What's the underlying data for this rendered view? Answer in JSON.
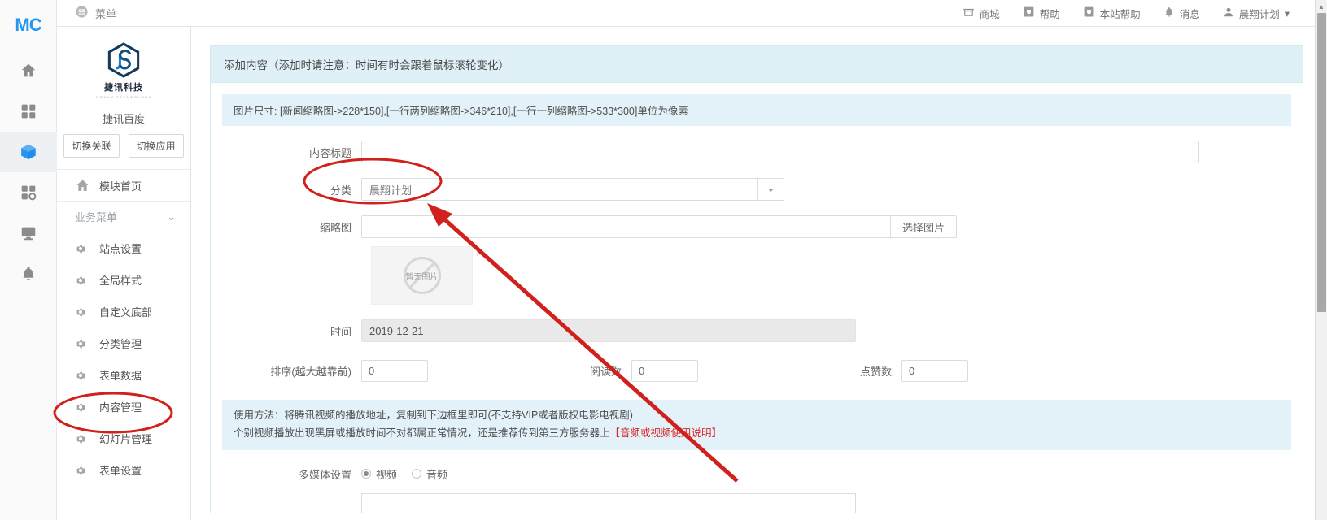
{
  "brand": {
    "logo_text": "MC"
  },
  "icon_rail": [
    {
      "name": "home-icon",
      "label": "首页"
    },
    {
      "name": "grid-icon",
      "label": "应用"
    },
    {
      "name": "cube-icon",
      "label": "模块",
      "active": true
    },
    {
      "name": "grid-settings-icon",
      "label": "设置"
    },
    {
      "name": "monitor-icon",
      "label": "监控"
    },
    {
      "name": "bell-icon",
      "label": "通知"
    }
  ],
  "topbar": {
    "menu_label": "菜单",
    "right_items": [
      {
        "icon": "shop-icon",
        "label": "商城"
      },
      {
        "icon": "help-icon",
        "label": "帮助"
      },
      {
        "icon": "site-help-icon",
        "label": "本站帮助"
      },
      {
        "icon": "bell-icon",
        "label": "消息"
      },
      {
        "icon": "user-icon",
        "label": "晨翔计划",
        "caret": "▾"
      }
    ]
  },
  "sidebar": {
    "logo_main": "捷讯科技",
    "logo_tiny": "JIEXUN TECHNOLOGY",
    "site_name": "捷讯百度",
    "switch_relation": "切换关联",
    "switch_app": "切换应用",
    "home_item": {
      "label": "模块首页",
      "icon": "home-icon"
    },
    "group_label": "业务菜单",
    "group_caret": "⌄",
    "items": [
      {
        "label": "站点设置",
        "icon": "gear-icon"
      },
      {
        "label": "全局样式",
        "icon": "gear-icon"
      },
      {
        "label": "自定义底部",
        "icon": "gear-icon"
      },
      {
        "label": "分类管理",
        "icon": "gear-icon"
      },
      {
        "label": "表单数据",
        "icon": "gear-icon"
      },
      {
        "label": "内容管理",
        "icon": "gear-icon",
        "highlighted": true
      },
      {
        "label": "幻灯片管理",
        "icon": "gear-icon"
      },
      {
        "label": "表单设置",
        "icon": "gear-icon"
      }
    ]
  },
  "panel": {
    "title": "添加内容（添加时请注意：时间有时会跟着鼠标滚轮变化）",
    "notice": "图片尺寸: [新闻缩略图->228*150],[一行两列缩略图->346*210],[一行一列缩略图->533*300]单位为像素",
    "fields": {
      "title": {
        "label": "内容标题",
        "value": "",
        "placeholder": ""
      },
      "category": {
        "label": "分类",
        "value": "晨翔计划",
        "caret": "▾"
      },
      "thumbnail": {
        "label": "缩略图",
        "value": "",
        "button": "选择图片",
        "preview_text": "暂无图片",
        "close": "×"
      },
      "time": {
        "label": "时间",
        "value": "2019-12-21"
      },
      "sort": {
        "label": "排序(越大越靠前)",
        "value": "0"
      },
      "reads": {
        "label": "阅读数",
        "value": "0"
      },
      "likes": {
        "label": "点赞数",
        "value": "0"
      }
    },
    "usage": {
      "line1": "使用方法：将腾讯视频的播放地址，复制到下边框里即可(不支持VIP或者版权电影电视剧)",
      "line2_pre": "个别视频播放出现黑屏或播放时间不对都属正常情况，还是推荐传到第三方服务器上",
      "line2_link": "【音频或视频使用说明】"
    },
    "media": {
      "label": "多媒体设置",
      "options": [
        {
          "label": "视频",
          "selected": true
        },
        {
          "label": "音频",
          "selected": false
        }
      ]
    }
  },
  "annotations": {
    "color": "#d0211c",
    "ellipse_category": "分类字段标注",
    "ellipse_menu": "内容管理菜单标注",
    "arrow": "指向分类字段的箭头"
  },
  "scrollbar": {
    "up_arrow": "▲"
  }
}
